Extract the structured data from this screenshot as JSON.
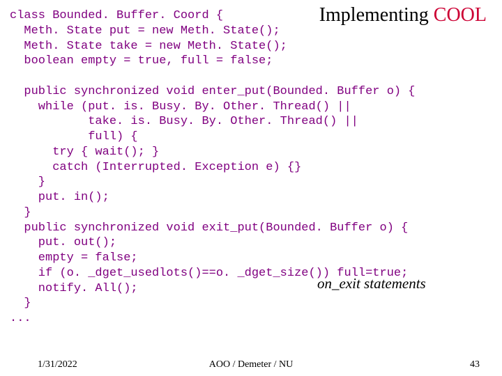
{
  "title": {
    "part1": "Implementing ",
    "part2": "COOL"
  },
  "code": "class Bounded. Buffer. Coord {\n  Meth. State put = new Meth. State();\n  Meth. State take = new Meth. State();\n  boolean empty = true, full = false;\n\n  public synchronized void enter_put(Bounded. Buffer o) {\n    while (put. is. Busy. By. Other. Thread() ||\n           take. is. Busy. By. Other. Thread() ||\n           full) {\n      try { wait(); }\n      catch (Interrupted. Exception e) {}\n    }\n    put. in();\n  }\n  public synchronized void exit_put(Bounded. Buffer o) {\n    put. out();\n    empty = false;\n    if (o. _dget_usedlots()==o. _dget_size()) full=true;\n    notify. All();\n  }\n...",
  "annotation": "on_exit statements",
  "footer": {
    "date": "1/31/2022",
    "center": "AOO / Demeter / NU",
    "page": "43"
  }
}
